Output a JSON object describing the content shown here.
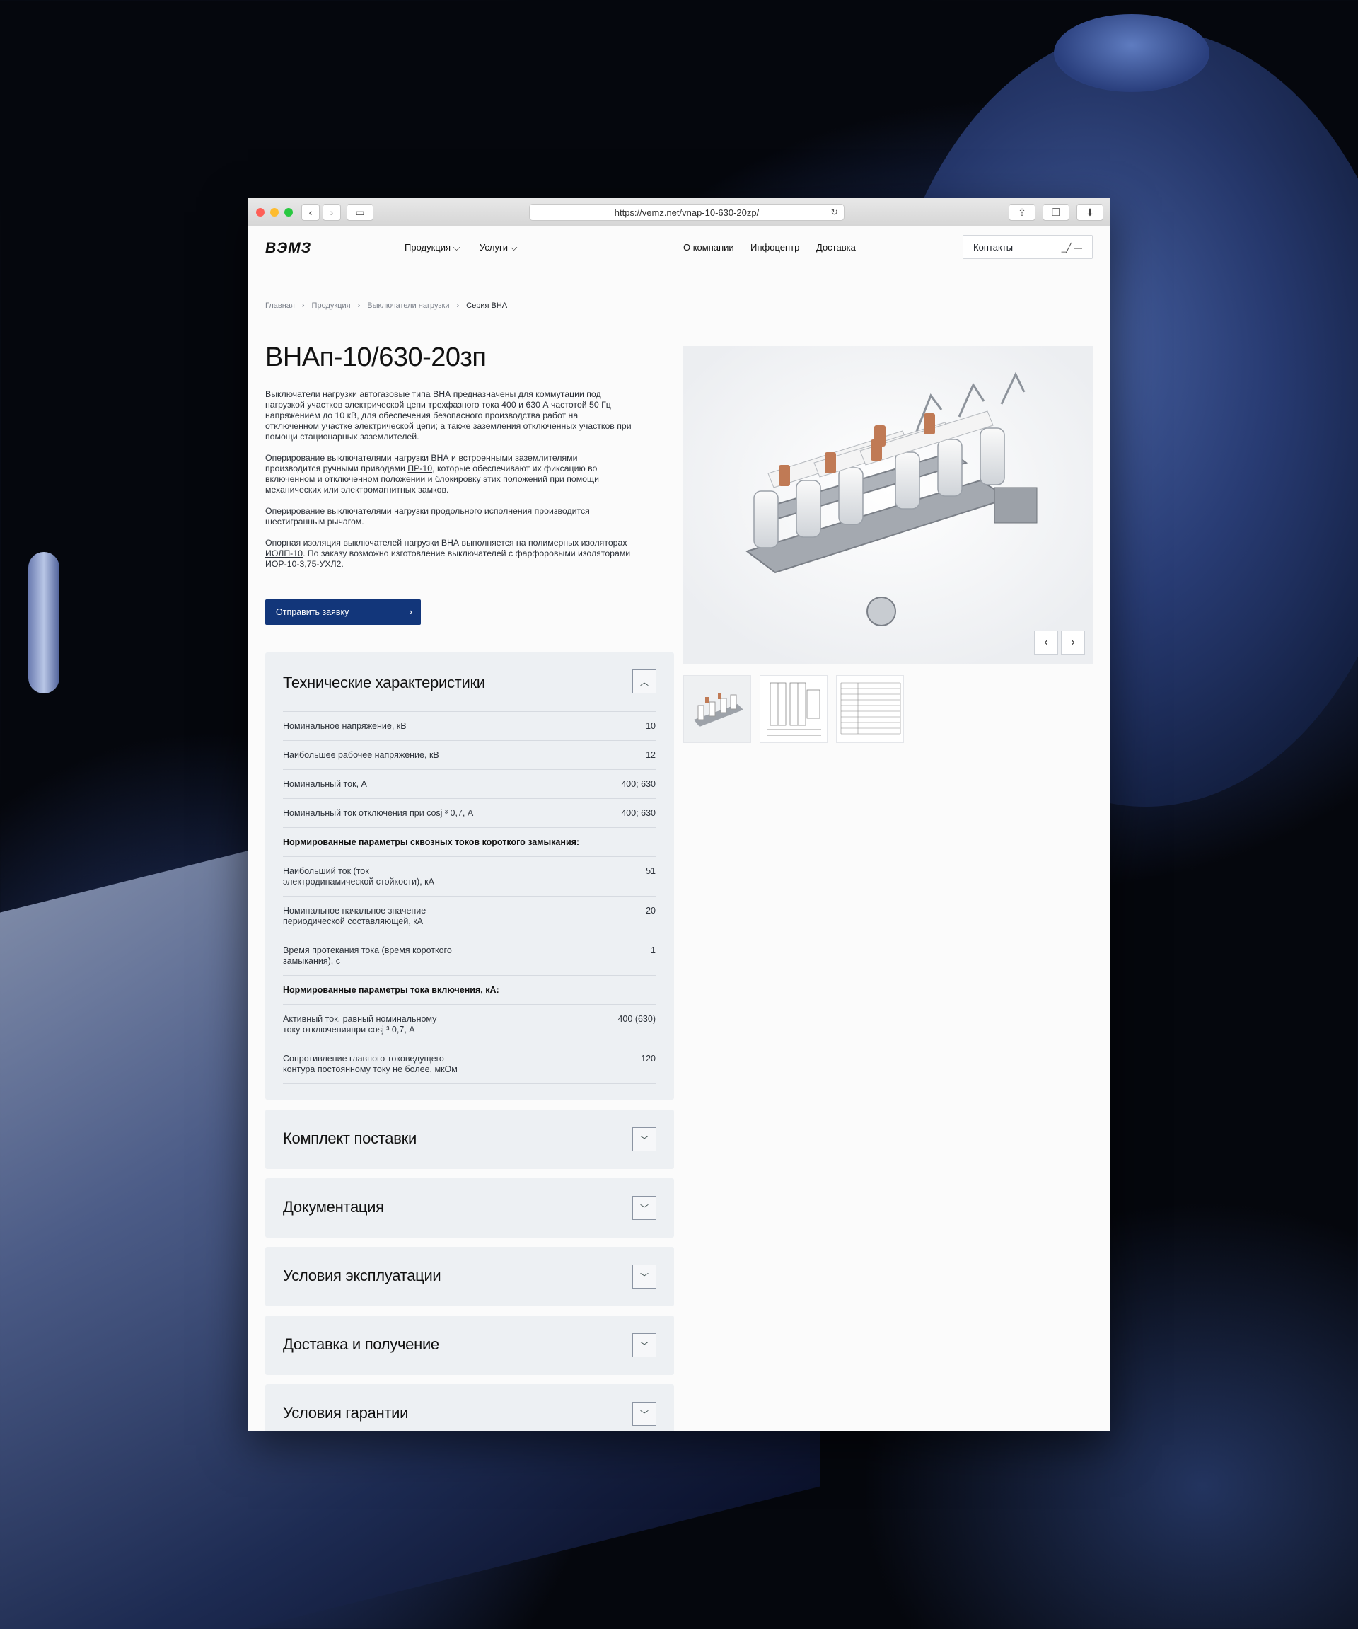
{
  "browser": {
    "url": "https://vemz.net/vnap-10-630-20zp/"
  },
  "header": {
    "logo": "ВЭМЗ",
    "nav": [
      {
        "label": "Продукция ⌵"
      },
      {
        "label": "Услуги ⌵"
      },
      {
        "label": "О компании"
      },
      {
        "label": "Инфоцентр"
      },
      {
        "label": "Доставка"
      }
    ],
    "contacts_label": "Контакты"
  },
  "breadcrumb": [
    "Главная",
    "Продукция",
    "Выключатели нагрузки",
    "Серия ВНА"
  ],
  "product": {
    "title": "ВНАп-10/630-20зп",
    "p1": "Выключатели нагрузки автогазовые типа ВНА предназначены для коммутации под нагрузкой участков электрической цепи трехфазного тока 400 и 630 А частотой 50 Гц напряжением до 10 кВ, для обеспечения безопасного производства работ на отключенном участке электрической цепи; а также заземления отключенных участков при помощи стационарных заземлителей.",
    "p2_a": "Оперирование выключателями нагрузки ВНА и встроенными заземлителями производится ручными приводами ",
    "p2_link": "ПР-10",
    "p2_b": ", которые обеспечивают их  фиксацию во включенном и отключенном положении и блокировку этих положений при помощи механических или электромагнитных замков.",
    "p3": "Оперирование выключателями нагрузки продольного исполнения производится шестигранным рычагом.",
    "p4_a": "Опорная изоляция выключателей нагрузки ВНА выполняется на полимерных изоляторах ",
    "p4_link": "ИОЛП-10",
    "p4_b": ". По заказу возможно изготовление выключателей с фарфоровыми изоляторами ИОР-10-3,75-УХЛ2.",
    "cta": "Отправить заявку"
  },
  "specs": {
    "title": "Технические характеристики",
    "rows": [
      {
        "label": "Номинальное напряжение, кВ",
        "value": "10"
      },
      {
        "label": "Наибольшее рабочее напряжение, кВ",
        "value": "12"
      },
      {
        "label": "Номинальный ток, А",
        "value": "400; 630"
      },
      {
        "label": "Номинальный ток отключения при cosj ³ 0,7, А",
        "value": "400; 630"
      },
      {
        "label": "Нормированные параметры сквозных токов короткого замыкания:",
        "value": "",
        "head": true
      },
      {
        "label": "Наибольший ток (ток\nэлектродинамической стойкости), кА",
        "value": "51"
      },
      {
        "label": "Номинальное начальное значение\nпериодической составляющей, кА",
        "value": "20"
      },
      {
        "label": "Время протекания тока (время короткого\nзамыкания), с",
        "value": "1"
      },
      {
        "label": "Нормированные параметры тока включения, кА:",
        "value": "",
        "head": true
      },
      {
        "label": "Активный ток, равный номинальному\nтоку отключенияпри cosj ³ 0,7, А",
        "value": "400 (630)"
      },
      {
        "label": "Сопротивление главного токоведущего\nконтура постоянному току не более, мкОм",
        "value": "120"
      }
    ]
  },
  "accordions": [
    {
      "title": "Комплект поставки"
    },
    {
      "title": "Документация"
    },
    {
      "title": "Условия эксплуатации"
    },
    {
      "title": "Доставка и получение"
    },
    {
      "title": "Условия гарантии"
    }
  ]
}
